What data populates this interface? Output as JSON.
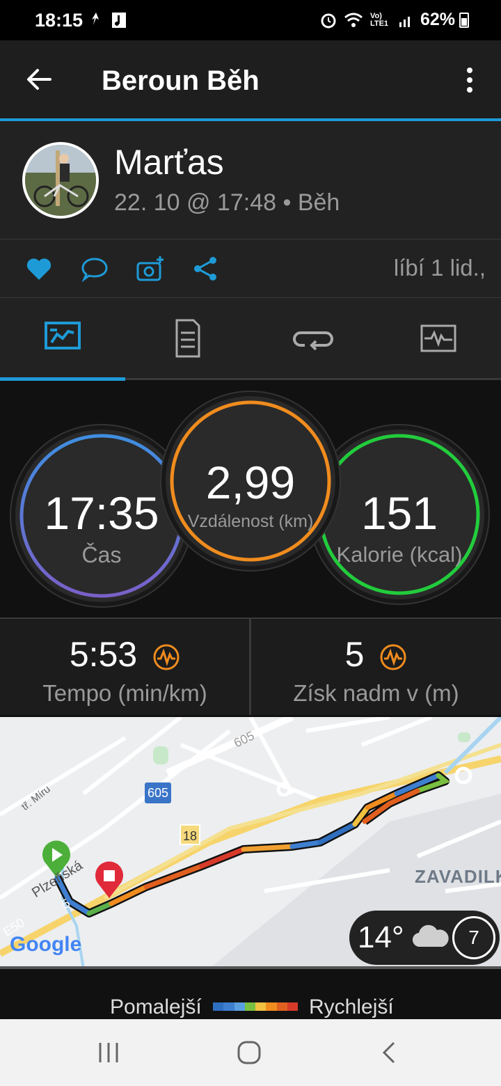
{
  "status_bar": {
    "time": "18:15",
    "network": "Vo) LTE1",
    "battery": "62%"
  },
  "app_bar": {
    "title": "Beroun Běh",
    "back_icon": "arrow-left-icon",
    "more_icon": "more-vert-icon"
  },
  "activity": {
    "user_name": "Marťas",
    "meta": "22. 10 @ 17:48 • Běh",
    "likes_text": "líbí 1 lid.,"
  },
  "actions": [
    "heart-icon",
    "comment-icon",
    "add-photo-icon",
    "share-icon"
  ],
  "tabs": [
    {
      "icon": "overview-tab-icon",
      "active": true
    },
    {
      "icon": "details-tab-icon",
      "active": false
    },
    {
      "icon": "laps-tab-icon",
      "active": false
    },
    {
      "icon": "charts-tab-icon",
      "active": false
    }
  ],
  "summary": {
    "time": {
      "value": "17:35",
      "label": "Čas"
    },
    "distance": {
      "value": "2,99",
      "label": "Vzdálenost (km)"
    },
    "calories": {
      "value": "151",
      "label": "Kalorie (kcal)"
    }
  },
  "stats": {
    "pace": {
      "value": "5:53",
      "label": "Tempo (min/km)"
    },
    "elevation": {
      "value": "5",
      "label": "Získ nadm v (m)"
    }
  },
  "map": {
    "labels": {
      "road_605": "605",
      "road_18": "18",
      "street_miru": "tř. Míru",
      "street_plzenska": "Plzeňská",
      "road_e50": "E50",
      "district": "ZAVADILK",
      "road_605_top": "605",
      "road_5": "5"
    },
    "attribution": "Google",
    "weather": {
      "temp": "14°",
      "wind": "7"
    }
  },
  "legend": {
    "slow": "Pomalejší",
    "fast": "Rychlejší"
  },
  "colors": {
    "accent": "#1e9bd7",
    "ring_time_top": "#3f8ee0",
    "ring_time_bottom": "#7a60c8",
    "ring_distance": "#f08c1e",
    "ring_calories": "#22cc3c"
  }
}
